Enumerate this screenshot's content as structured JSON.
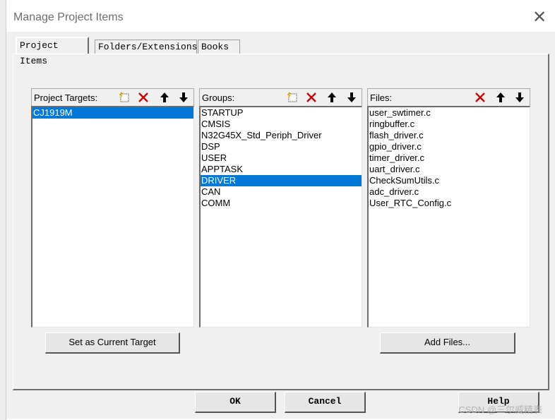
{
  "window": {
    "title": "Manage Project Items"
  },
  "tabs": [
    {
      "label": "Project Items"
    },
    {
      "label": "Folders/Extensions"
    },
    {
      "label": "Books"
    }
  ],
  "panes": {
    "targets": {
      "label": "Project Targets:",
      "items": [
        "CJ1919M"
      ],
      "selected": 0
    },
    "groups": {
      "label": "Groups:",
      "items": [
        "STARTUP",
        "CMSIS",
        "N32G45X_Std_Periph_Driver",
        "DSP",
        "USER",
        "APPTASK",
        "DRIVER",
        "CAN",
        "COMM"
      ],
      "selected": 6
    },
    "files": {
      "label": "Files:",
      "items": [
        "user_swtimer.c",
        "ringbuffer.c",
        "flash_driver.c",
        "gpio_driver.c",
        "timer_driver.c",
        "uart_driver.c",
        "CheckSumUtils.c",
        "adc_driver.c",
        "User_RTC_Config.c"
      ],
      "selected": -1
    }
  },
  "buttons": {
    "set_target": "Set as Current Target",
    "add_files": "Add Files...",
    "ok": "OK",
    "cancel": "Cancel",
    "help": "Help"
  },
  "icons": {
    "new": "new-item-icon",
    "delete": "delete-icon",
    "up": "arrow-up-icon",
    "down": "arrow-down-icon"
  },
  "colors": {
    "selection": "#0078d7",
    "delete_icon": "#c00000"
  },
  "watermark": "CSDN @三尔威精表"
}
